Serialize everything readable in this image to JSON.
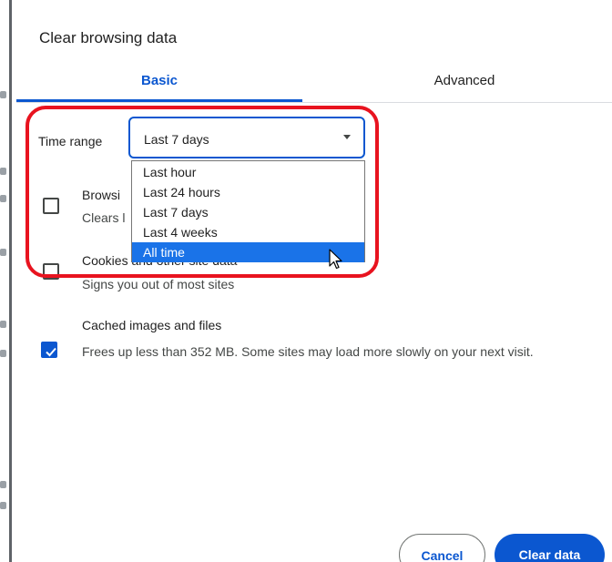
{
  "dialog": {
    "title": "Clear browsing data"
  },
  "tabs": [
    {
      "label": "Basic",
      "active": true
    },
    {
      "label": "Advanced",
      "active": false
    }
  ],
  "time_range": {
    "label": "Time range",
    "selected_value": "Last 7 days",
    "options": [
      "Last hour",
      "Last 24 hours",
      "Last 7 days",
      "Last 4 weeks",
      "All time"
    ],
    "hovered_option": "All time"
  },
  "items": [
    {
      "title": "Browsi",
      "description": "Clears l",
      "checked": false
    },
    {
      "title": "Cookies and other site data",
      "description": "Signs you out of most sites",
      "checked": false
    },
    {
      "title": "Cached images and files",
      "description": "Frees up less than 352 MB. Some sites may load more slowly on your next visit.",
      "checked": true
    }
  ],
  "buttons": {
    "cancel": "Cancel",
    "clear": "Clear data"
  },
  "colors": {
    "accent": "#0b57d0",
    "highlight_option": "#1a73e8",
    "annotation": "#e8131f"
  },
  "icons": {
    "dropdown": "chevron-down-icon",
    "checkmark": "check-icon",
    "cursor": "mouse-pointer-icon"
  }
}
